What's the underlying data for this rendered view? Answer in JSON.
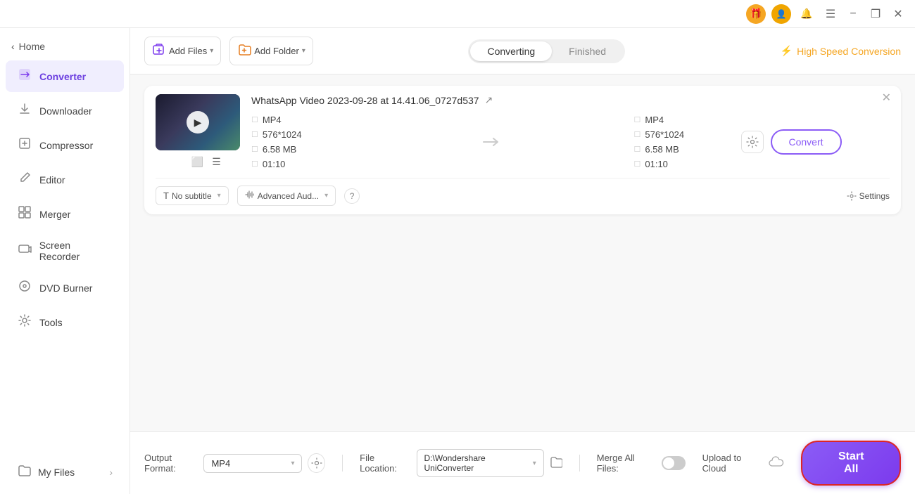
{
  "titlebar": {
    "gift_icon": "🎁",
    "user_icon": "👤",
    "bell_icon": "🔔",
    "menu_icon": "☰",
    "minimize_label": "−",
    "restore_label": "❐",
    "close_label": "✕"
  },
  "sidebar": {
    "back_label": "Home",
    "items": [
      {
        "id": "converter",
        "label": "Converter",
        "icon": "⬛"
      },
      {
        "id": "downloader",
        "label": "Downloader",
        "icon": "⬇"
      },
      {
        "id": "compressor",
        "label": "Compressor",
        "icon": "🗜"
      },
      {
        "id": "editor",
        "label": "Editor",
        "icon": "✏"
      },
      {
        "id": "merger",
        "label": "Merger",
        "icon": "⊞"
      },
      {
        "id": "screen-recorder",
        "label": "Screen Recorder",
        "icon": "📷"
      },
      {
        "id": "dvd-burner",
        "label": "DVD Burner",
        "icon": "💿"
      },
      {
        "id": "tools",
        "label": "Tools",
        "icon": "⚙"
      }
    ],
    "bottom": {
      "label": "My Files",
      "icon": "📁"
    }
  },
  "toolbar": {
    "add_file_label": "Add Files",
    "add_folder_label": "Add Folder",
    "tab_converting": "Converting",
    "tab_finished": "Finished",
    "high_speed_label": "High Speed Conversion"
  },
  "video": {
    "title": "WhatsApp Video 2023-09-28 at 14.41.06_0727d537",
    "src_format": "MP4",
    "src_resolution": "576*1024",
    "src_size": "6.58 MB",
    "src_duration": "01:10",
    "dst_format": "MP4",
    "dst_resolution": "576*1024",
    "dst_size": "6.58 MB",
    "dst_duration": "01:10",
    "convert_btn_label": "Convert",
    "subtitle_label": "No subtitle",
    "advanced_label": "Advanced Aud...",
    "settings_label": "Settings"
  },
  "bottom_bar": {
    "output_format_label": "Output Format:",
    "output_format_value": "MP4",
    "file_location_label": "File Location:",
    "file_location_value": "D:\\Wondershare UniConverter",
    "merge_label": "Merge All Files:",
    "upload_label": "Upload to Cloud",
    "start_all_label": "Start All"
  }
}
